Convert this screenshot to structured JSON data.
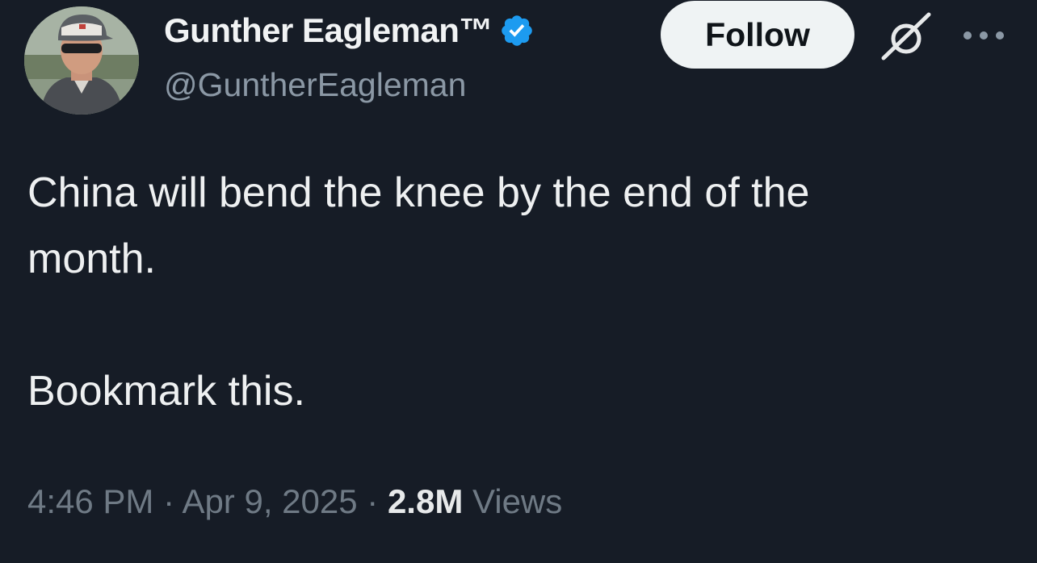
{
  "author": {
    "display_name": "Gunther Eagleman™",
    "handle": "@GuntherEagleman",
    "verified": true,
    "verified_color": "#1d9bf0"
  },
  "actions": {
    "follow_label": "Follow"
  },
  "icons": {
    "verified": "verified-badge-icon",
    "grok": "grok-icon",
    "more": "more-options-icon"
  },
  "tweet": {
    "text": "China will bend the knee by the end of the\nmonth.\n\nBookmark this."
  },
  "meta": {
    "time": "4:46 PM",
    "separator": " · ",
    "date": "Apr 9, 2025",
    "views_count": "2.8M",
    "views_label": "Views"
  }
}
